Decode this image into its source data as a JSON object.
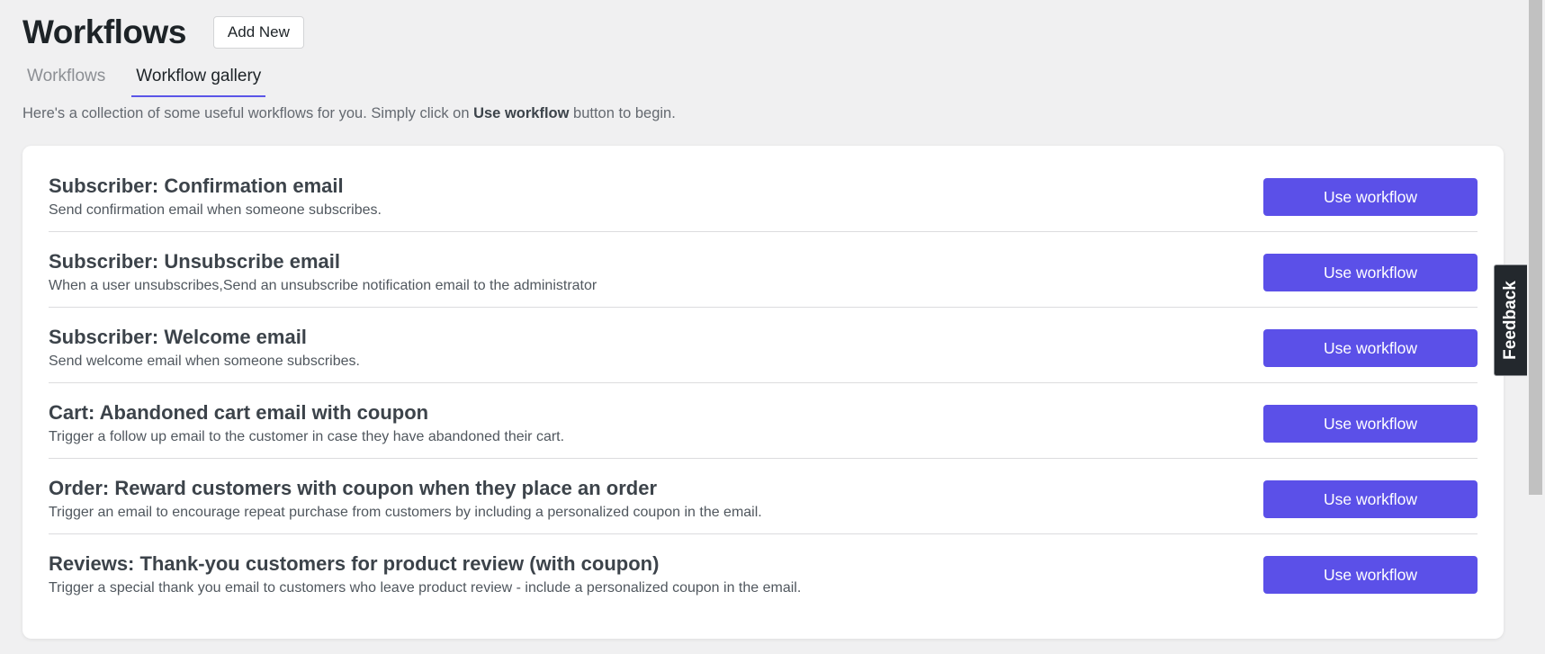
{
  "header": {
    "title": "Workflows",
    "add_new_label": "Add New"
  },
  "tabs": [
    {
      "label": "Workflows",
      "active": false
    },
    {
      "label": "Workflow gallery",
      "active": true
    }
  ],
  "intro": {
    "prefix": "Here's a collection of some useful workflows for you. Simply click on ",
    "emphasis": "Use workflow",
    "suffix": " button to begin."
  },
  "workflows": [
    {
      "title": "Subscriber: Confirmation email",
      "description": "Send confirmation email when someone subscribes.",
      "button_label": "Use workflow"
    },
    {
      "title": "Subscriber: Unsubscribe email",
      "description": "When a user unsubscribes,Send an unsubscribe notification email to the administrator",
      "button_label": "Use workflow"
    },
    {
      "title": "Subscriber: Welcome email",
      "description": "Send welcome email when someone subscribes.",
      "button_label": "Use workflow"
    },
    {
      "title": "Cart: Abandoned cart email with coupon",
      "description": "Trigger a follow up email to the customer in case they have abandoned their cart.",
      "button_label": "Use workflow"
    },
    {
      "title": "Order: Reward customers with coupon when they place an order",
      "description": "Trigger an email to encourage repeat purchase from customers by including a personalized coupon in the email.",
      "button_label": "Use workflow"
    },
    {
      "title": "Reviews: Thank-you customers for product review (with coupon)",
      "description": "Trigger a special thank you email to customers who leave product review - include a personalized coupon in the email.",
      "button_label": "Use workflow"
    }
  ],
  "feedback": {
    "label": "Feedback"
  },
  "colors": {
    "accent": "#5b50e8",
    "background": "#f0f0f1",
    "card": "#ffffff",
    "feedback_bg": "#23282d"
  }
}
